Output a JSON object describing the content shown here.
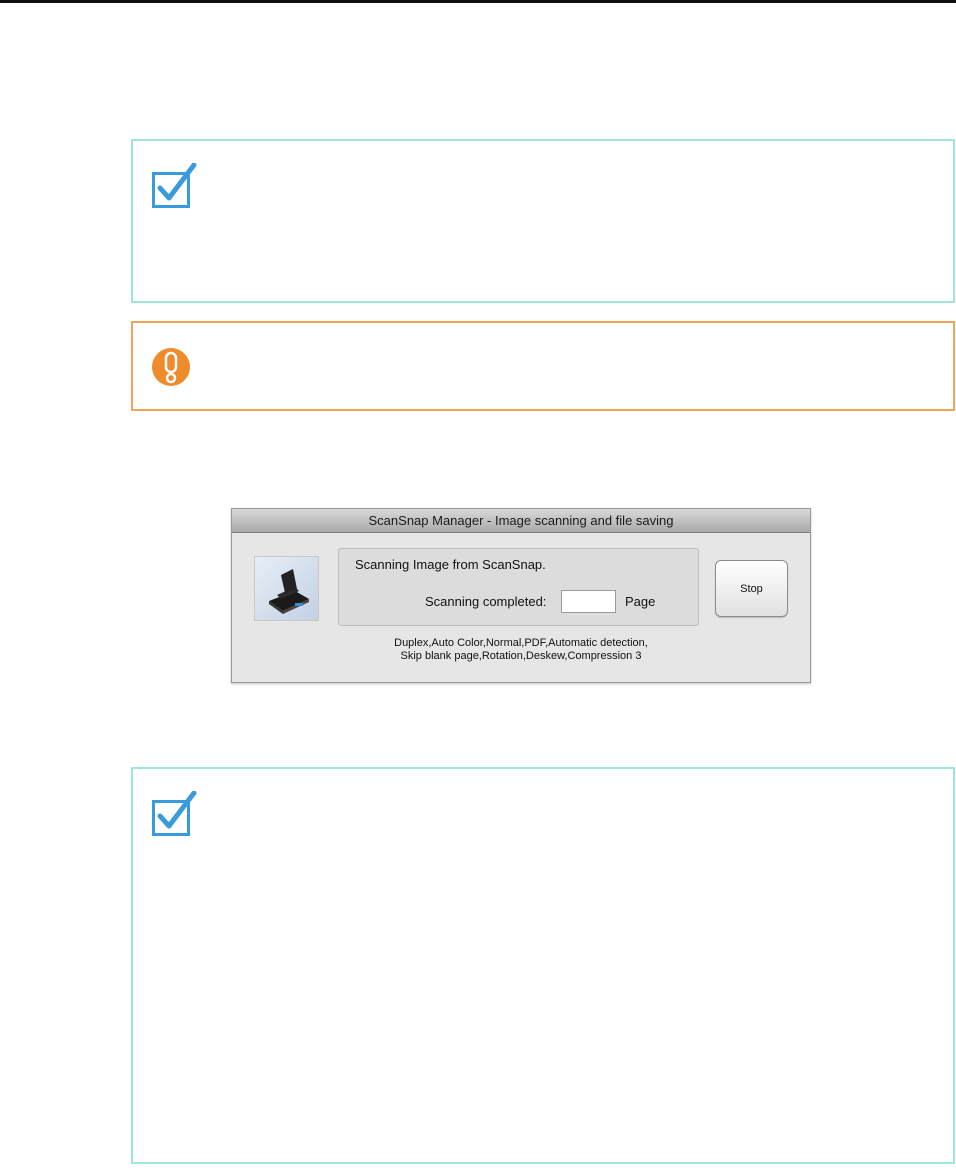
{
  "dialog": {
    "title": "ScanSnap Manager - Image scanning and file saving",
    "status": "Scanning Image from ScanSnap.",
    "completed_label": "Scanning completed:",
    "page_count": "",
    "page_label": "Page",
    "stop_label": "Stop",
    "settings_line1": "Duplex,Auto Color,Normal,PDF,Automatic detection,",
    "settings_line2": "Skip blank page,Rotation,Deskew,Compression 3"
  },
  "icons": {
    "hint": "checkmark-icon",
    "caution": "exclamation-icon",
    "scanner": "scanner-icon"
  },
  "colors": {
    "hint_border": "#9ee5da",
    "caution_border": "#f0a65a",
    "check_blue": "#3a9bdc",
    "caution_orange": "#ee8b2a"
  }
}
